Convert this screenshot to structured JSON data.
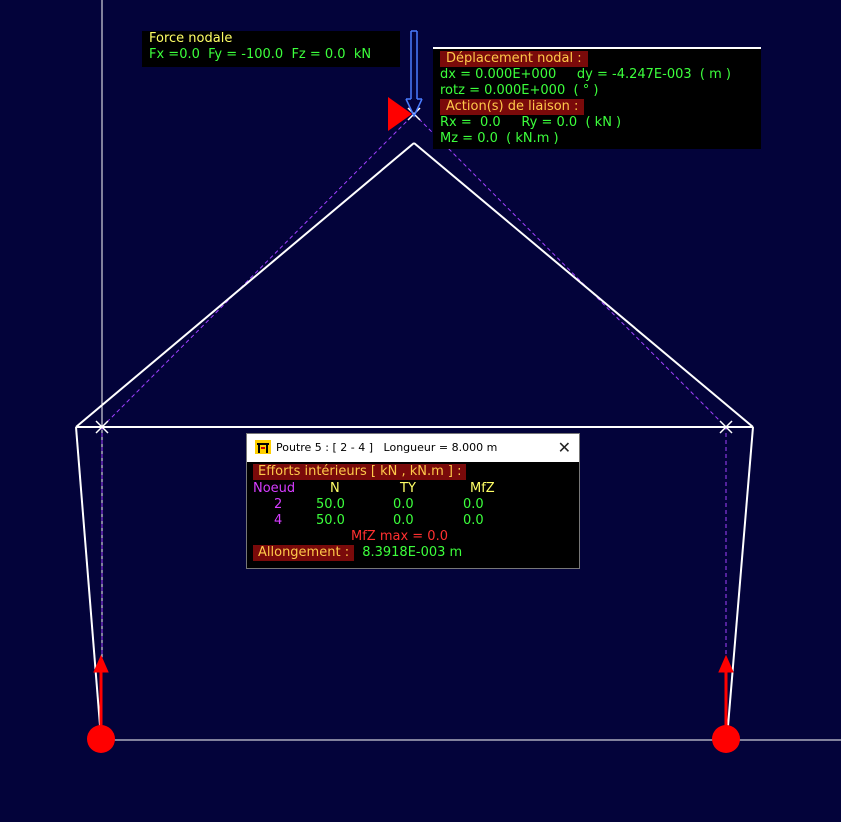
{
  "nodal_force": {
    "title": "Force nodale",
    "values": "Fx =0.0  Fy = -100.0  Fz = 0.0  kN"
  },
  "nodal_displacement": {
    "title": "Déplacement nodal :",
    "line1": "dx = 0.000E+000     dy = -4.247E-003  ( m )",
    "line2": "rotz = 0.000E+000  ( ° )",
    "reactions_title": "Action(s) de liaison :",
    "line3": "Rx =  0.0     Ry = 0.0  ( kN )",
    "line4": "Mz = 0.0  ( kN.m )"
  },
  "beam_popup": {
    "title": "Poutre 5 : [ 2 - 4 ]   Longueur = 8.000 m",
    "close": "✕",
    "efforts_title": "Efforts intérieurs [ kN , kN.m ] :",
    "columns": [
      "Noeud",
      "N",
      "TY",
      "MfZ"
    ],
    "rows": [
      [
        "2",
        "50.0",
        "0.0",
        "0.0"
      ],
      [
        "4",
        "50.0",
        "0.0",
        "0.0"
      ]
    ],
    "mfz_max": "MfZ max = 0.0",
    "elongation_label": "Allongement :",
    "elongation_value": "8.3918E-003 m"
  },
  "colors": {
    "background": "#03033a",
    "structure": "#ffffff",
    "deformed": "#a040ff",
    "support": "#ff0000",
    "load_arrow": "#4a7dff"
  },
  "icons": [
    "app-icon",
    "close-icon",
    "pinned-support-icon",
    "reaction-arrow-icon",
    "nodal-load-arrow-icon",
    "node-cross-icon"
  ]
}
